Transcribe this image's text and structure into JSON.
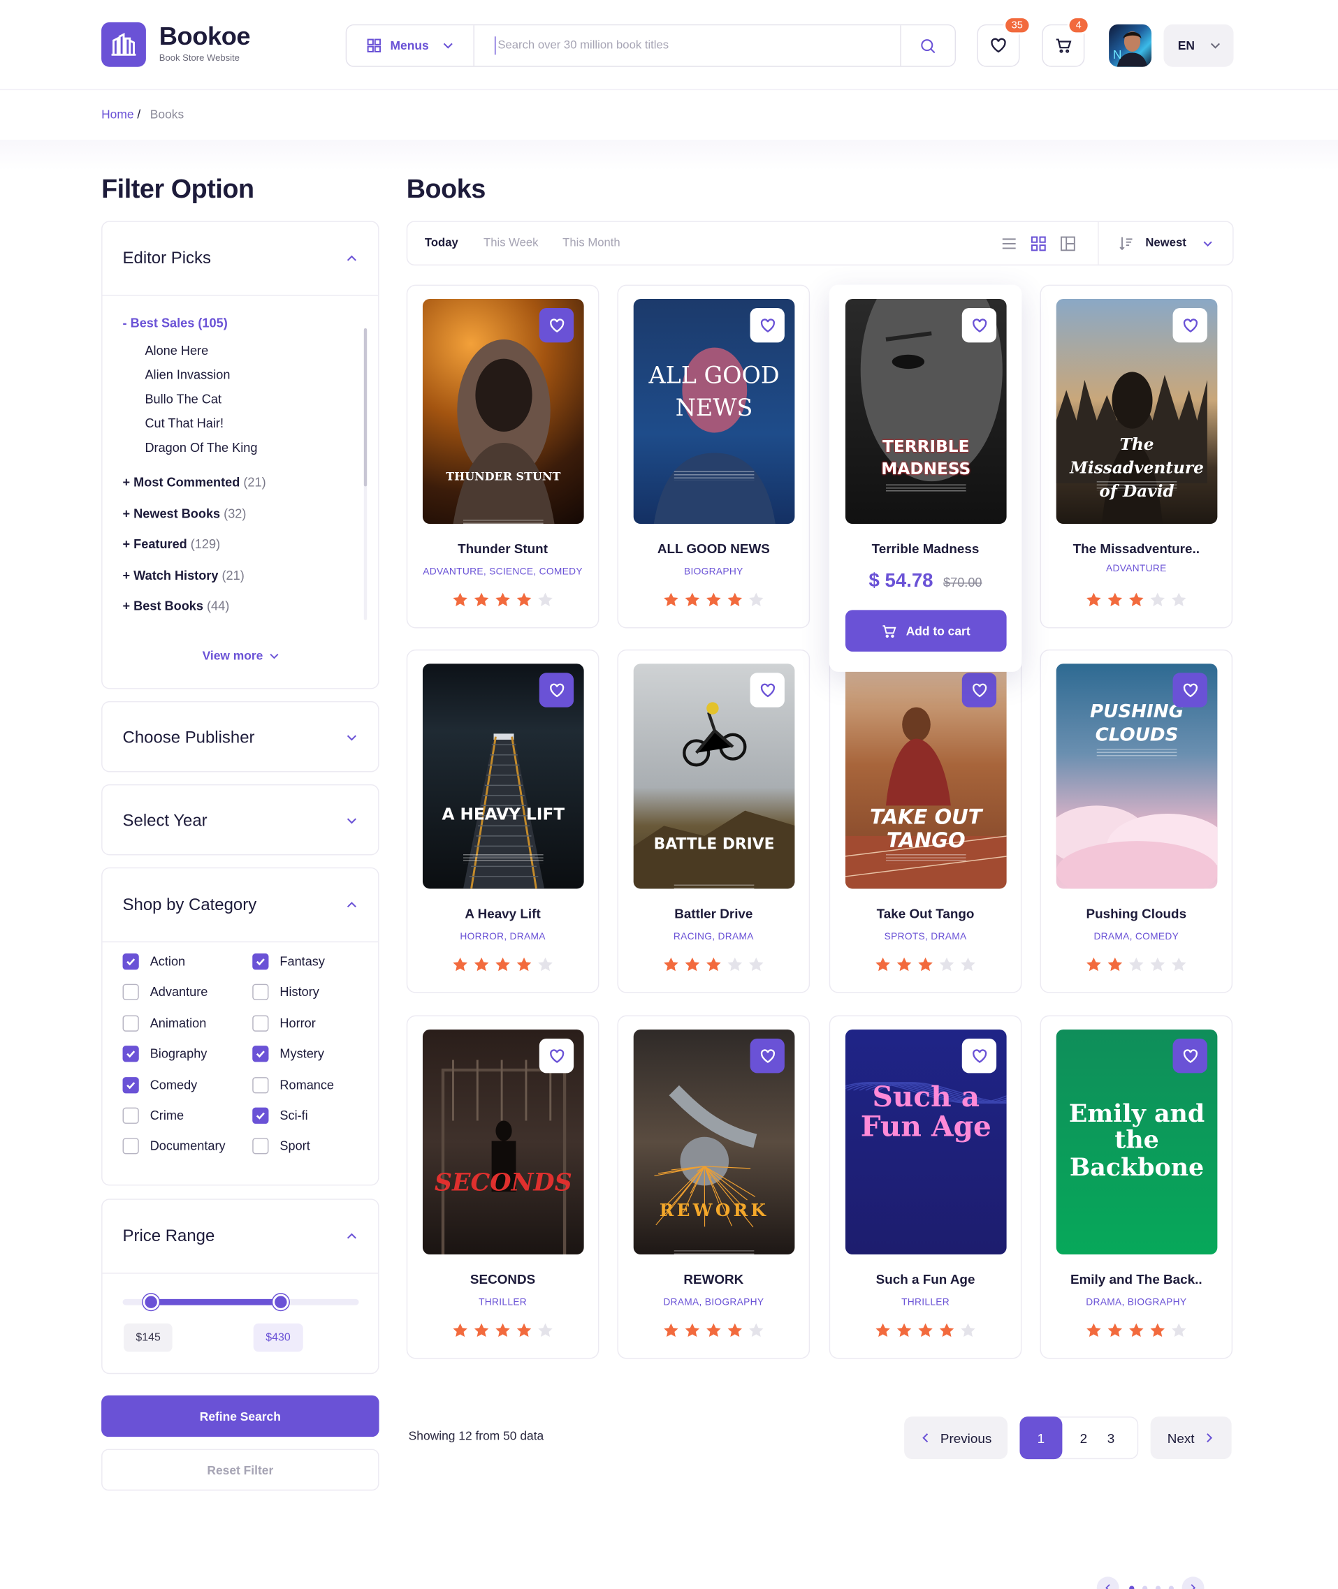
{
  "header": {
    "brand": "Bookoe",
    "tagline": "Book Store Website",
    "menus_label": "Menus",
    "search_placeholder": "Search over 30 million book titles",
    "wishlist_count": "35",
    "cart_count": "4",
    "language": "EN"
  },
  "breadcrumb": {
    "home": "Home",
    "separator": "/",
    "current": "Books"
  },
  "filter": {
    "title": "Filter Option",
    "editor_picks": {
      "title": "Editor Picks",
      "main": "- Best Sales (105)",
      "sub_items": [
        "Alone Here",
        "Alien Invassion",
        "Bullo The Cat",
        "Cut That Hair!",
        "Dragon Of The King"
      ],
      "groups": [
        {
          "label": "+ Most Commented",
          "count": "(21)"
        },
        {
          "label": "+ Newest Books",
          "count": "(32)"
        },
        {
          "label": "+ Featured",
          "count": "(129)"
        },
        {
          "label": "+ Watch History",
          "count": "(21)"
        },
        {
          "label": "+ Best Books",
          "count": "(44)"
        }
      ],
      "view_more": "View more"
    },
    "publisher": "Choose Publisher",
    "year": "Select Year",
    "category": {
      "title": "Shop by Category",
      "items": [
        {
          "label": "Action",
          "checked": true
        },
        {
          "label": "Fantasy",
          "checked": true
        },
        {
          "label": "Advanture",
          "checked": false
        },
        {
          "label": "History",
          "checked": false
        },
        {
          "label": "Animation",
          "checked": false
        },
        {
          "label": "Horror",
          "checked": false
        },
        {
          "label": "Biography",
          "checked": true
        },
        {
          "label": "Mystery",
          "checked": true
        },
        {
          "label": "Comedy",
          "checked": true
        },
        {
          "label": "Romance",
          "checked": false
        },
        {
          "label": "Crime",
          "checked": false
        },
        {
          "label": "Sci-fi",
          "checked": true
        },
        {
          "label": "Documentary",
          "checked": false
        },
        {
          "label": "Sport",
          "checked": false
        }
      ]
    },
    "price": {
      "title": "Price Range",
      "min_label": "$145",
      "max_label": "$430",
      "min_fraction": 0.12,
      "max_fraction": 0.67
    },
    "refine": "Refine Search",
    "reset": "Reset Filter"
  },
  "books_section": {
    "title": "Books",
    "tabs": [
      "Today",
      "This Week",
      "This Month"
    ],
    "sort": "Newest"
  },
  "books": [
    {
      "title": "Thunder Stunt",
      "genre": "ADVANTURE, SCIENCE, COMEDY",
      "rating": 4,
      "favorite": true,
      "cover_text": "THUNDER STUNT"
    },
    {
      "title": "ALL GOOD NEWS",
      "genre": "BIOGRAPHY",
      "rating": 4,
      "favorite": false,
      "cover_text": "ALL GOOD NEWS"
    },
    {
      "title": "Terrible Madness",
      "genre": "",
      "rating": 0,
      "favorite": false,
      "cover_text": "TERRIBLE MADNESS",
      "price": "$ 54.78",
      "old_price": "$70.00",
      "cta": "Add to cart"
    },
    {
      "title": "The Missadventure..",
      "genre": "ADVANTURE",
      "rating": 3,
      "favorite": false,
      "cover_text": "The Missadventure of David"
    },
    {
      "title": "A Heavy Lift",
      "genre": "HORROR, DRAMA",
      "rating": 4,
      "favorite": true,
      "cover_text": "A HEAVY LIFT"
    },
    {
      "title": "Battler Drive",
      "genre": "RACING, DRAMA",
      "rating": 3,
      "favorite": false,
      "cover_text": "BATTLE DRIVE"
    },
    {
      "title": "Take Out Tango",
      "genre": "SPROTS, DRAMA",
      "rating": 3,
      "favorite": true,
      "cover_text": "TAKE OUT TANGO"
    },
    {
      "title": "Pushing Clouds",
      "genre": "DRAMA, COMEDY",
      "rating": 2,
      "favorite": true,
      "cover_text": "PUSHING CLOUDS"
    },
    {
      "title": "SECONDS",
      "genre": "THRILLER",
      "rating": 4,
      "favorite": false,
      "cover_text": "SECONDS"
    },
    {
      "title": "REWORK",
      "genre": "DRAMA, BIOGRAPHY",
      "rating": 4,
      "favorite": true,
      "cover_text": "REWORK"
    },
    {
      "title": "Such a Fun Age",
      "genre": "THRILLER",
      "rating": 4,
      "favorite": false,
      "cover_text": "Such a Fun Age"
    },
    {
      "title": "Emily and The Back..",
      "genre": "DRAMA, BIOGRAPHY",
      "rating": 4,
      "favorite": true,
      "cover_text": "Emily and the Backbone"
    }
  ],
  "pagination": {
    "showing": "Showing 12 from 50 data",
    "previous": "Previous",
    "next": "Next",
    "pages": [
      "1",
      "2",
      "3"
    ],
    "active": "1"
  },
  "colors": {
    "accent": "#6a52d6",
    "star": "#f26a3d",
    "star_empty": "#e4e3ea"
  },
  "icons": [
    "logo-icon",
    "grid-icon",
    "chevron-down-icon",
    "search-icon",
    "heart-icon",
    "cart-icon",
    "list-view-icon",
    "grid-view-icon",
    "column-view-icon",
    "sort-icon",
    "star-icon",
    "chevron-left-icon",
    "chevron-right-icon"
  ]
}
